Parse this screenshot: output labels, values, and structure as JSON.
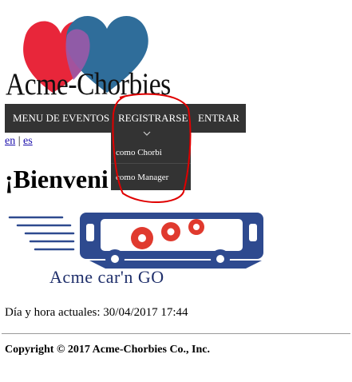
{
  "brand": {
    "name": "Acme-Chorbies",
    "heart_colors": [
      "#e8263a",
      "#2f6d9a",
      "#9b59a8"
    ]
  },
  "menu": {
    "items": [
      {
        "label": "MENU DE EVENTOS"
      },
      {
        "label": "REGISTRARSE"
      },
      {
        "label": "ENTRAR"
      }
    ],
    "dropdown": [
      {
        "label": "como Chorbi"
      },
      {
        "label": "como Manager"
      }
    ]
  },
  "language": {
    "en": "en",
    "separator": "|",
    "es": "es"
  },
  "welcome": "¡Bienveni",
  "banner": {
    "caption": "Acme car'n GO"
  },
  "datetime": "Día y hora actuales: 30/04/2017 17:44",
  "footer": {
    "copyright": "Copyright © 2017 Acme-Chorbies Co., Inc."
  },
  "colors": {
    "menubar": "#333333",
    "annotation": "#e00000",
    "car_blue": "#2e4a8f",
    "gear_red": "#e03a2e"
  }
}
